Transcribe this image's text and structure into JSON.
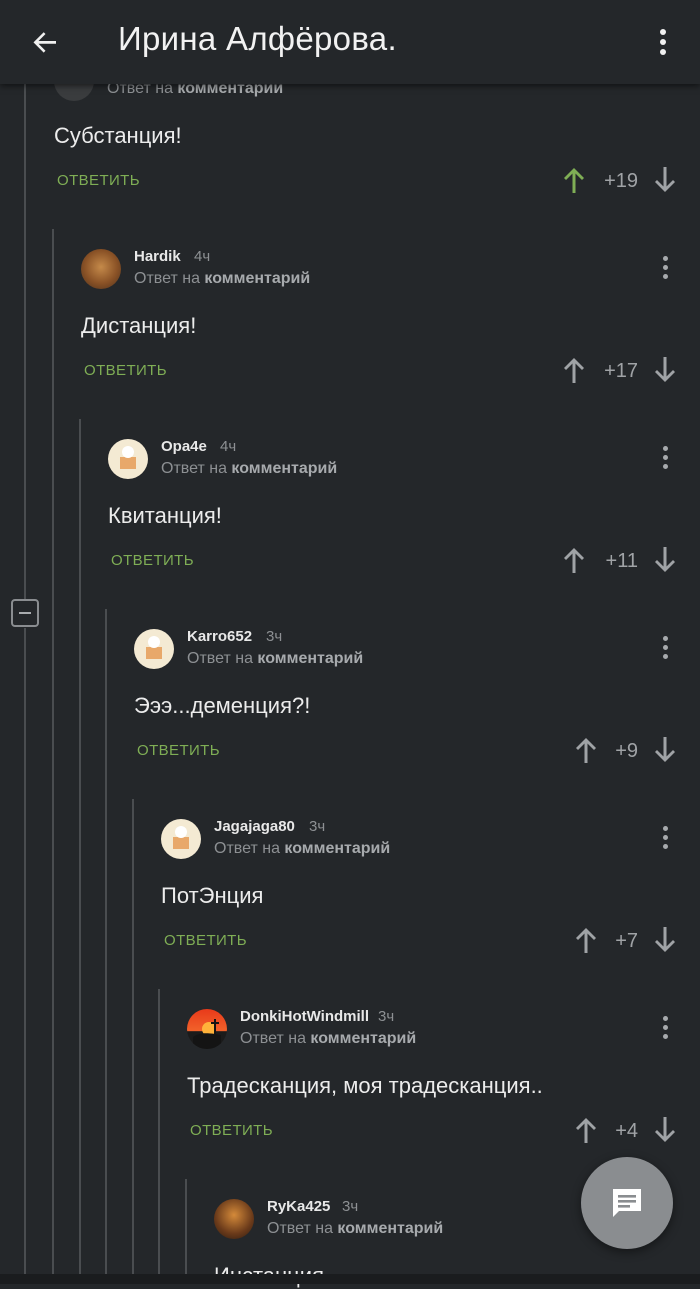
{
  "header": {
    "title": "Ирина Алфёрова.",
    "back_icon": "arrow-left-icon",
    "menu_icon": "more-vertical-icon"
  },
  "reply_prefix": "Ответ на",
  "reply_link_top": "комментарии",
  "reply_link": "комментарий",
  "answer_label": "ОТВЕТИТЬ",
  "colors": {
    "accent_green": "#7fae55",
    "background": "#24272a",
    "upvoted": "#7fae55"
  },
  "comments": [
    {
      "author": "",
      "time": "",
      "text": "Субстанция!",
      "votes": "+19",
      "upvoted": true
    },
    {
      "author": "Hardik",
      "time": "4ч",
      "text": "Дистанция!",
      "votes": "+17"
    },
    {
      "author": "Opa4e",
      "time": "4ч",
      "text": "Квитанция!",
      "votes": "+11"
    },
    {
      "author": "Karro652",
      "time": "3ч",
      "text": "Эээ...деменция?!",
      "votes": "+9"
    },
    {
      "author": "Jagajaga80",
      "time": "3ч",
      "text": "ПотЭнция",
      "votes": "+7"
    },
    {
      "author": "DonkiHotWindmill",
      "time": "3ч",
      "text": "Традесканция, моя традесканция..",
      "votes": "+4"
    },
    {
      "author": "RyKa425",
      "time": "3ч",
      "text": "Инстанция",
      "votes": ""
    }
  ],
  "fab_icon": "comment-icon"
}
